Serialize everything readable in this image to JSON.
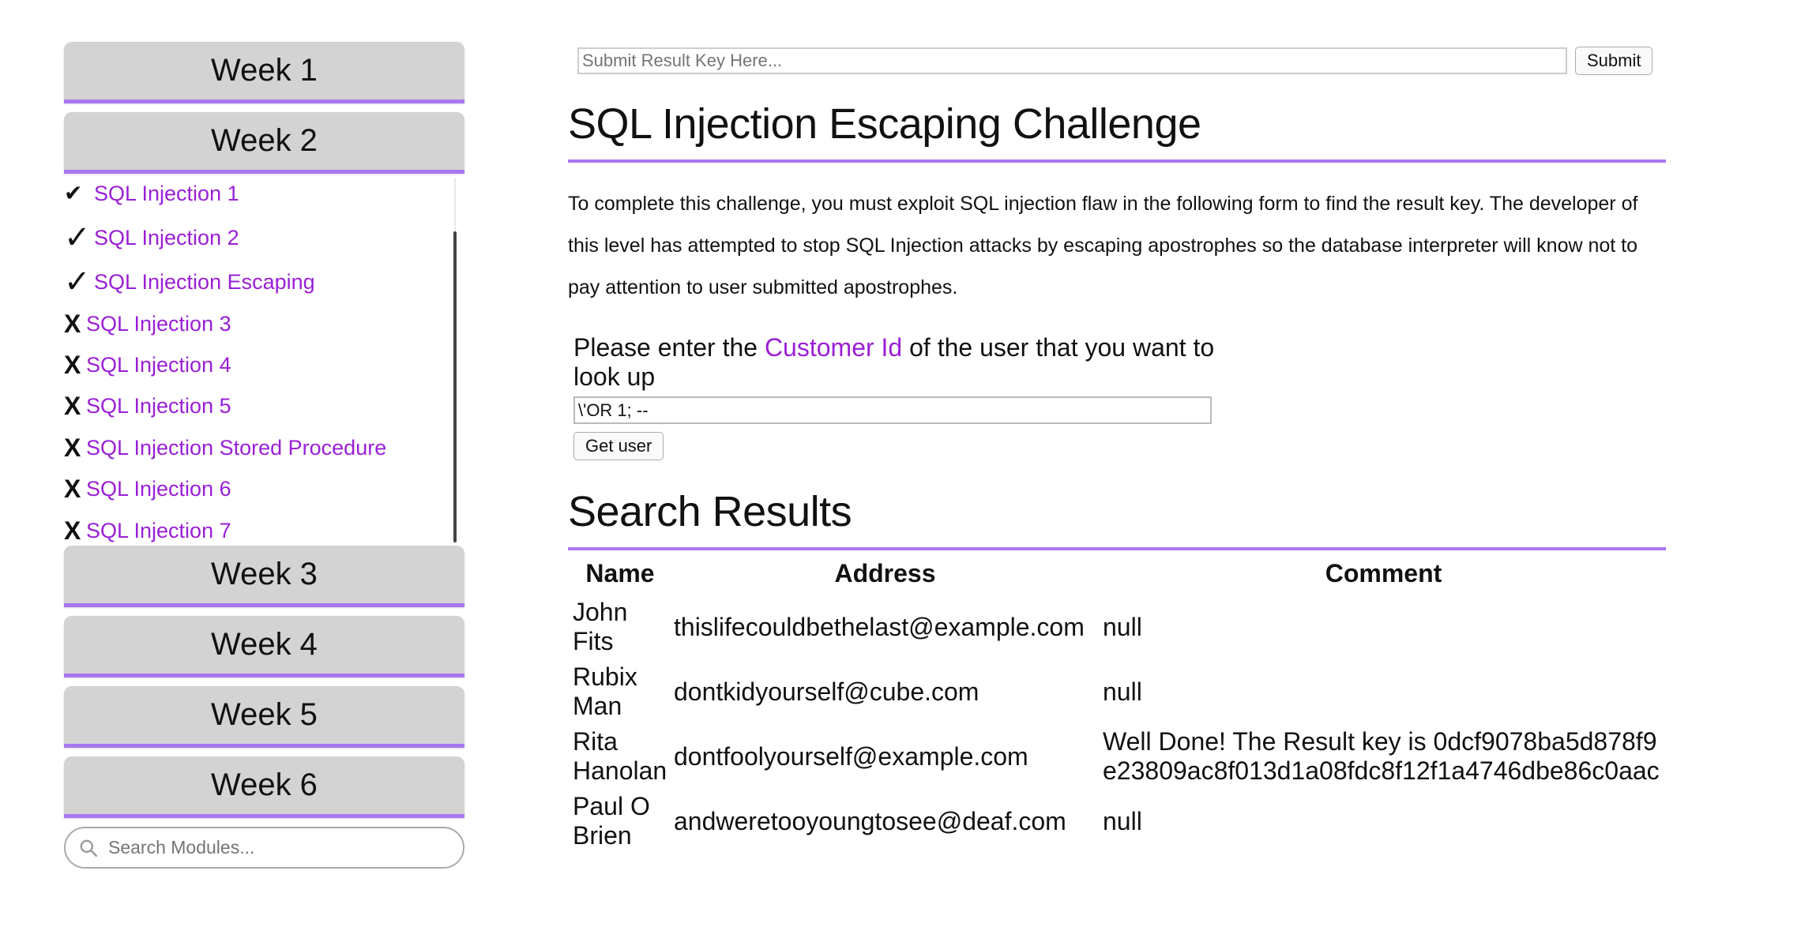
{
  "sidebar": {
    "weeks": [
      "Week 1",
      "Week 2",
      "Week 3",
      "Week 4",
      "Week 5",
      "Week 6"
    ],
    "modules": [
      {
        "label": "SQL Injection 1",
        "status": "completed",
        "mark": "✔"
      },
      {
        "label": "SQL Injection 2",
        "status": "completed",
        "mark": "✓"
      },
      {
        "label": "SQL Injection Escaping",
        "status": "completed",
        "mark": "✓"
      },
      {
        "label": "SQL Injection 3",
        "status": "incomplete",
        "mark": "X"
      },
      {
        "label": "SQL Injection 4",
        "status": "incomplete",
        "mark": "X"
      },
      {
        "label": "SQL Injection 5",
        "status": "incomplete",
        "mark": "X"
      },
      {
        "label": "SQL Injection Stored Procedure",
        "status": "incomplete",
        "mark": "X"
      },
      {
        "label": "SQL Injection 6",
        "status": "incomplete",
        "mark": "X"
      },
      {
        "label": "SQL Injection 7",
        "status": "incomplete",
        "mark": "X"
      }
    ],
    "search_placeholder": "Search Modules..."
  },
  "result_key": {
    "placeholder": "Submit Result Key Here...",
    "submit_label": "Submit"
  },
  "main": {
    "title": "SQL Injection Escaping Challenge",
    "description": "To complete this challenge, you must exploit SQL injection flaw in the following form to find the result key. The developer of this level has attempted to stop SQL Injection attacks by escaping apostrophes so the database interpreter will know not to pay attention to user submitted apostrophes.",
    "prompt_before": "Please enter the ",
    "prompt_highlight": "Customer Id",
    "prompt_after": " of the user that you want to look up",
    "customer_input_value": "\\'OR 1; --",
    "get_user_label": "Get user",
    "results_title": "Search Results",
    "table": {
      "headers": [
        "Name",
        "Address",
        "Comment"
      ],
      "rows": [
        {
          "name": "John Fits",
          "address": "thislifecouldbethelast@example.com",
          "comment": "null"
        },
        {
          "name": "Rubix Man",
          "address": "dontkidyourself@cube.com",
          "comment": "null"
        },
        {
          "name": "Rita Hanolan",
          "address": "dontfoolyourself@example.com",
          "comment": "Well Done! The Result key is 0dcf9078ba5d878f9e23809ac8f013d1a08fdc8f12f1a4746dbe86c0aac"
        },
        {
          "name": "Paul O Brien",
          "address": "andweretooyoungtosee@deaf.com",
          "comment": "null"
        }
      ]
    }
  },
  "colors": {
    "accent": "#a877f0",
    "link": "#9a1fd6",
    "week_button_bg": "#d3d3d3"
  }
}
